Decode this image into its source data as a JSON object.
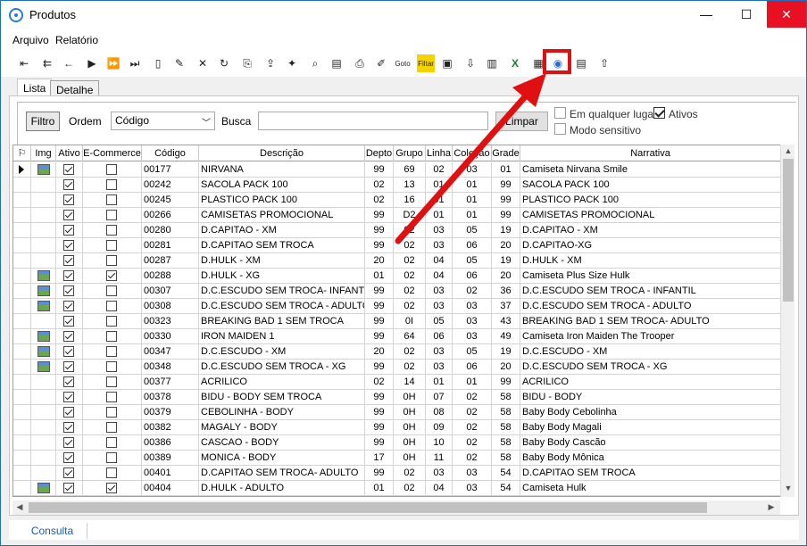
{
  "window": {
    "title": "Produtos",
    "min_glyph": "—",
    "max_glyph": "☐",
    "close_glyph": "✕"
  },
  "menu": [
    "Arquivo",
    "Relatório"
  ],
  "toolbar_icons": [
    "first-record-icon",
    "prev-page-icon",
    "prev-record-icon",
    "next-record-icon",
    "next-page-icon",
    "last-record-icon",
    "new-icon",
    "edit-icon",
    "delete-icon",
    "refresh-icon",
    "copy-icon",
    "export-icon",
    "magic-icon",
    "find-icon",
    "report-icon",
    "print-icon",
    "tag-icon",
    "goto-icon",
    "filter-icon",
    "photo-icon",
    "import-icon",
    "barcode-icon",
    "excel-icon",
    "grid-export-icon",
    "ecommerce-sync-icon",
    "document-icon",
    "upload-icon"
  ],
  "toolbar_labels": {
    "goto": "Goto",
    "filter": "Filtar"
  },
  "tabs": [
    "Lista",
    "Detalhe"
  ],
  "filter": {
    "filtro_label": "Filtro",
    "ordem_label": "Ordem",
    "ordem_value": "Código",
    "busca_label": "Busca",
    "busca_value": "",
    "limpar_label": "Limpar",
    "em_qualquer_lugar": {
      "label": "Em qualquer lugar",
      "checked": false
    },
    "ativos": {
      "label": "Ativos",
      "checked": true
    },
    "modo_sensitivo": {
      "label": "Modo sensitivo",
      "checked": false
    }
  },
  "columns": [
    "",
    "Img",
    "Ativo",
    "E-Commerce",
    "Código",
    "Descrição",
    "Depto",
    "Grupo",
    "Linha",
    "Coleção",
    "Grade",
    "Narrativa"
  ],
  "rows": [
    {
      "img": true,
      "ativo": true,
      "ecom": false,
      "codigo": "00177",
      "descricao": "NIRVANA",
      "depto": "99",
      "grupo": "69",
      "linha": "02",
      "colecao": "03",
      "grade": "01",
      "narrativa": "Camiseta Nirvana Smile"
    },
    {
      "img": false,
      "ativo": true,
      "ecom": false,
      "codigo": "00242",
      "descricao": "SACOLA PACK 100",
      "depto": "02",
      "grupo": "13",
      "linha": "01",
      "colecao": "01",
      "grade": "99",
      "narrativa": "SACOLA PACK 100"
    },
    {
      "img": false,
      "ativo": true,
      "ecom": false,
      "codigo": "00245",
      "descricao": "PLASTICO PACK 100",
      "depto": "02",
      "grupo": "16",
      "linha": "01",
      "colecao": "01",
      "grade": "99",
      "narrativa": "PLASTICO PACK 100"
    },
    {
      "img": false,
      "ativo": true,
      "ecom": false,
      "codigo": "00266",
      "descricao": "CAMISETAS PROMOCIONAL",
      "depto": "99",
      "grupo": "D2",
      "linha": "01",
      "colecao": "01",
      "grade": "99",
      "narrativa": "CAMISETAS PROMOCIONAL"
    },
    {
      "img": false,
      "ativo": true,
      "ecom": false,
      "codigo": "00280",
      "descricao": "D.CAPITAO - XM",
      "depto": "99",
      "grupo": "02",
      "linha": "03",
      "colecao": "05",
      "grade": "19",
      "narrativa": "D.CAPITAO - XM"
    },
    {
      "img": false,
      "ativo": true,
      "ecom": false,
      "codigo": "00281",
      "descricao": "D.CAPITAO SEM TROCA",
      "depto": "99",
      "grupo": "02",
      "linha": "03",
      "colecao": "06",
      "grade": "20",
      "narrativa": "D.CAPITAO-XG"
    },
    {
      "img": false,
      "ativo": true,
      "ecom": false,
      "codigo": "00287",
      "descricao": "D.HULK - XM",
      "depto": "20",
      "grupo": "02",
      "linha": "04",
      "colecao": "05",
      "grade": "19",
      "narrativa": "D.HULK - XM"
    },
    {
      "img": true,
      "ativo": true,
      "ecom": true,
      "codigo": "00288",
      "descricao": "D.HULK - XG",
      "depto": "01",
      "grupo": "02",
      "linha": "04",
      "colecao": "06",
      "grade": "20",
      "narrativa": "Camiseta Plus Size Hulk"
    },
    {
      "img": true,
      "ativo": true,
      "ecom": false,
      "codigo": "00307",
      "descricao": "D.C.ESCUDO SEM TROCA- INFANTI",
      "depto": "99",
      "grupo": "02",
      "linha": "03",
      "colecao": "02",
      "grade": "36",
      "narrativa": "D.C.ESCUDO SEM TROCA - INFANTIL"
    },
    {
      "img": true,
      "ativo": true,
      "ecom": false,
      "codigo": "00308",
      "descricao": "D.C.ESCUDO SEM TROCA - ADULTO",
      "depto": "99",
      "grupo": "02",
      "linha": "03",
      "colecao": "03",
      "grade": "37",
      "narrativa": "D.C.ESCUDO SEM TROCA - ADULTO"
    },
    {
      "img": false,
      "ativo": true,
      "ecom": false,
      "codigo": "00323",
      "descricao": "BREAKING BAD 1 SEM TROCA",
      "depto": "99",
      "grupo": "0I",
      "linha": "05",
      "colecao": "03",
      "grade": "43",
      "narrativa": "BREAKING BAD 1 SEM TROCA- ADULTO"
    },
    {
      "img": true,
      "ativo": true,
      "ecom": false,
      "codigo": "00330",
      "descricao": "IRON MAIDEN 1",
      "depto": "99",
      "grupo": "64",
      "linha": "06",
      "colecao": "03",
      "grade": "49",
      "narrativa": "Camiseta Iron Maiden The Trooper"
    },
    {
      "img": true,
      "ativo": true,
      "ecom": false,
      "codigo": "00347",
      "descricao": "D.C.ESCUDO - XM",
      "depto": "20",
      "grupo": "02",
      "linha": "03",
      "colecao": "05",
      "grade": "19",
      "narrativa": "D.C.ESCUDO - XM"
    },
    {
      "img": true,
      "ativo": true,
      "ecom": false,
      "codigo": "00348",
      "descricao": "D.C.ESCUDO SEM TROCA - XG",
      "depto": "99",
      "grupo": "02",
      "linha": "03",
      "colecao": "06",
      "grade": "20",
      "narrativa": "D.C.ESCUDO SEM TROCA - XG"
    },
    {
      "img": false,
      "ativo": true,
      "ecom": false,
      "codigo": "00377",
      "descricao": "ACRILICO",
      "depto": "02",
      "grupo": "14",
      "linha": "01",
      "colecao": "01",
      "grade": "99",
      "narrativa": "ACRILICO"
    },
    {
      "img": false,
      "ativo": true,
      "ecom": false,
      "codigo": "00378",
      "descricao": "BIDU - BODY SEM TROCA",
      "depto": "99",
      "grupo": "0H",
      "linha": "07",
      "colecao": "02",
      "grade": "58",
      "narrativa": "BIDU - BODY"
    },
    {
      "img": false,
      "ativo": true,
      "ecom": false,
      "codigo": "00379",
      "descricao": "CEBOLINHA - BODY",
      "depto": "99",
      "grupo": "0H",
      "linha": "08",
      "colecao": "02",
      "grade": "58",
      "narrativa": "Baby Body Cebolinha"
    },
    {
      "img": false,
      "ativo": true,
      "ecom": false,
      "codigo": "00382",
      "descricao": "MAGALY - BODY",
      "depto": "99",
      "grupo": "0H",
      "linha": "09",
      "colecao": "02",
      "grade": "58",
      "narrativa": "Baby Body Magali"
    },
    {
      "img": false,
      "ativo": true,
      "ecom": false,
      "codigo": "00386",
      "descricao": "CASCAO - BODY",
      "depto": "99",
      "grupo": "0H",
      "linha": "10",
      "colecao": "02",
      "grade": "58",
      "narrativa": "Baby Body Cascão"
    },
    {
      "img": false,
      "ativo": true,
      "ecom": false,
      "codigo": "00389",
      "descricao": "MONICA - BODY",
      "depto": "17",
      "grupo": "0H",
      "linha": "11",
      "colecao": "02",
      "grade": "58",
      "narrativa": "Baby Body Mônica"
    },
    {
      "img": false,
      "ativo": true,
      "ecom": false,
      "codigo": "00401",
      "descricao": "D.CAPITAO SEM TROCA- ADULTO",
      "depto": "99",
      "grupo": "02",
      "linha": "03",
      "colecao": "03",
      "grade": "54",
      "narrativa": "D.CAPITAO SEM TROCA"
    },
    {
      "img": true,
      "ativo": true,
      "ecom": true,
      "codigo": "00404",
      "descricao": "D.HULK - ADULTO",
      "depto": "01",
      "grupo": "02",
      "linha": "04",
      "colecao": "03",
      "grade": "54",
      "narrativa": "Camiseta Hulk"
    }
  ],
  "selected_row": 0,
  "status": {
    "tab": "Consulta"
  },
  "colors": {
    "highlight": "#e01010",
    "accent": "#1e6fc2"
  }
}
